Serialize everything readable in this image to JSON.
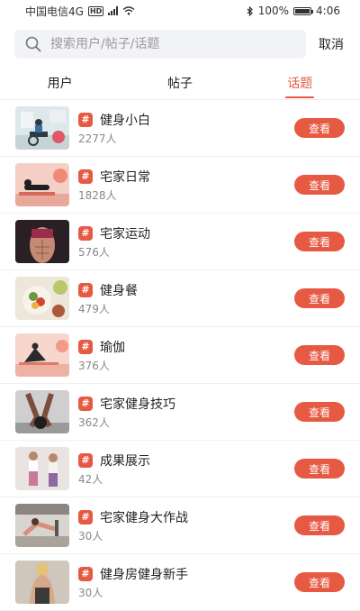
{
  "status_bar": {
    "carrier": "中国电信4G",
    "hd": "HD",
    "network": "4G",
    "battery": "100%",
    "time": "4:06"
  },
  "search": {
    "placeholder": "搜索用户/帖子/话题",
    "cancel_label": "取消"
  },
  "tabs": [
    {
      "label": "用户",
      "active": false
    },
    {
      "label": "帖子",
      "active": false
    },
    {
      "label": "话题",
      "active": true
    }
  ],
  "topics": [
    {
      "title": "健身小白",
      "count": "2277人",
      "button": "查看",
      "thumb": "gym-cycling-illustration"
    },
    {
      "title": "宅家日常",
      "count": "1828人",
      "button": "查看",
      "thumb": "home-workout-illustration"
    },
    {
      "title": "宅家运动",
      "count": "576人",
      "button": "查看",
      "thumb": "abs-photo"
    },
    {
      "title": "健身餐",
      "count": "479人",
      "button": "查看",
      "thumb": "salad-photo"
    },
    {
      "title": "瑜伽",
      "count": "376人",
      "button": "查看",
      "thumb": "yoga-illustration"
    },
    {
      "title": "宅家健身技巧",
      "count": "362人",
      "button": "查看",
      "thumb": "kettlebell-photo"
    },
    {
      "title": "成果展示",
      "count": "42人",
      "button": "查看",
      "thumb": "women-fitness-photo"
    },
    {
      "title": "宅家健身大作战",
      "count": "30人",
      "button": "查看",
      "thumb": "gym-stretch-photo"
    },
    {
      "title": "健身房健身新手",
      "count": "30人",
      "button": "查看",
      "thumb": "gym-back-photo"
    }
  ],
  "colors": {
    "accent": "#e65a44",
    "search_bg": "#f2f3f7"
  }
}
